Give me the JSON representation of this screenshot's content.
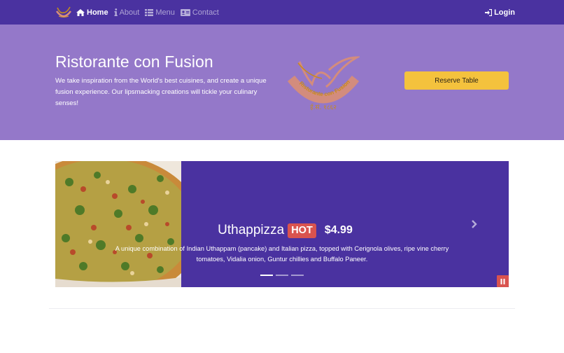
{
  "navbar": {
    "brand_icon": "ristorante-logo-icon",
    "items": [
      {
        "label": "Home",
        "icon": "home-icon",
        "active": true
      },
      {
        "label": "About",
        "icon": "info-icon",
        "active": false
      },
      {
        "label": "Menu",
        "icon": "list-icon",
        "active": false
      },
      {
        "label": "Contact",
        "icon": "address-card-icon",
        "active": false
      }
    ],
    "login_label": "Login",
    "login_icon": "sign-in-icon"
  },
  "jumbotron": {
    "title": "Ristorante con Fusion",
    "description": "We take inspiration from the World's best cuisines, and create a unique fusion experience. Our lipsmacking creations will tickle your culinary senses!",
    "logo_arc_text": "Ristorante con Fusion",
    "logo_est_text": "ई.सं. १८६२",
    "reserve_label": "Reserve Table"
  },
  "carousel": {
    "item_name": "Uthappizza",
    "badge": "HOT",
    "price": "$4.99",
    "description": "A unique combination of Indian Uthappam (pancake) and Italian pizza, topped with Cerignola olives, ripe vine cherry tomatoes, Vidalia onion, Guntur chillies and Buffalo Paneer.",
    "slide_count": 3,
    "active_slide": 1,
    "next_icon": "chevron-right-icon",
    "pause_icon": "pause-icon"
  },
  "colors": {
    "navbar_bg": "#4a32a0",
    "jumbotron_bg": "#9478c9",
    "reserve_button": "#f4c23d",
    "hot_badge": "#d9534f"
  }
}
